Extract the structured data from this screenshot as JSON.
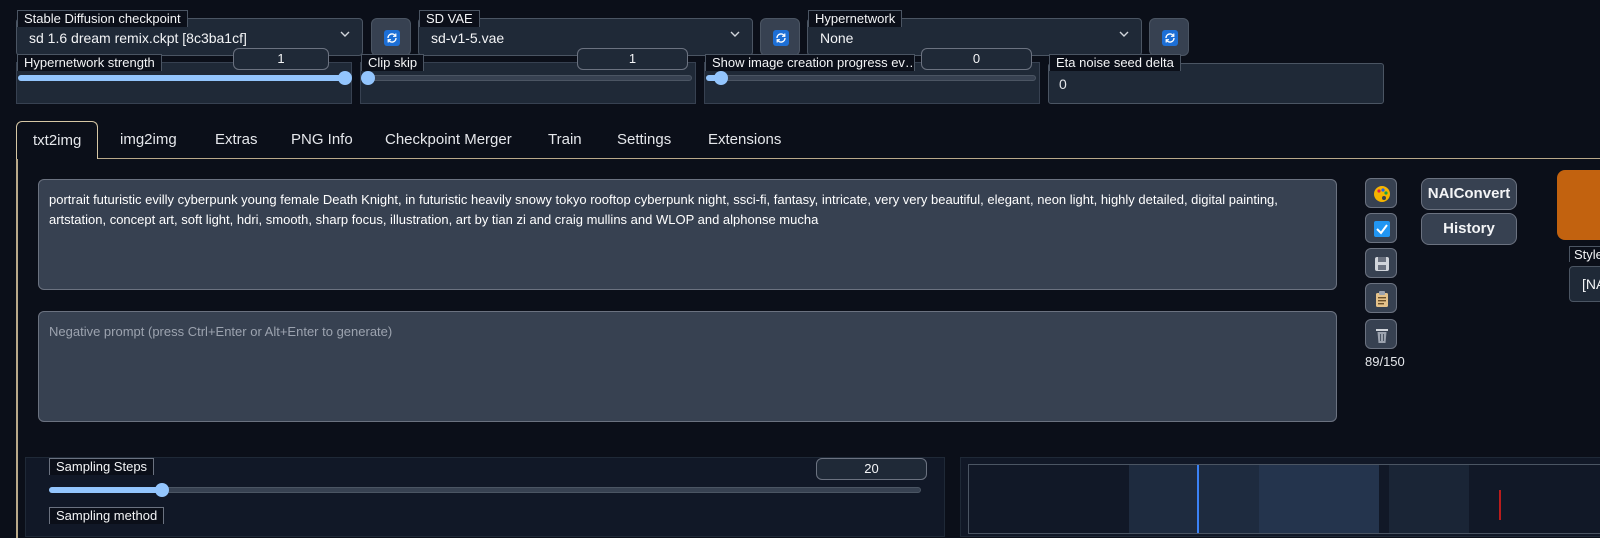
{
  "settings": {
    "checkpoint_label": "Stable Diffusion checkpoint",
    "checkpoint_value": "sd 1.6 dream remix.ckpt [8c3ba1cf]",
    "vae_label": "SD VAE",
    "vae_value": "sd-v1-5.vae",
    "hypernetwork_label": "Hypernetwork",
    "hypernetwork_value": "None",
    "hypernetwork_strength_label": "Hypernetwork strength",
    "hypernetwork_strength_value": "1",
    "clip_skip_label": "Clip skip",
    "clip_skip_value": "1",
    "progress_label": "Show image creation progress ev…",
    "progress_value": "0",
    "eta_label": "Eta noise seed delta",
    "eta_value": "0"
  },
  "tabs": [
    "txt2img",
    "img2img",
    "Extras",
    "PNG Info",
    "Checkpoint Merger",
    "Train",
    "Settings",
    "Extensions"
  ],
  "active_tab": "txt2img",
  "prompt": {
    "text": "portrait futuristic evilly cyberpunk young female Death Knight, in futuristic heavily snowy tokyo rooftop cyberpunk night, ssci-fi, fantasy, intricate, very very beautiful, elegant, neon light, highly detailed, digital painting, artstation, concept art, soft light, hdri, smooth, sharp focus, illustration, art by tian zi and craig mullins and WLOP and alphonse mucha",
    "negative_placeholder": "Negative prompt (press Ctrl+Enter or Alt+Enter to generate)",
    "token_counter": "89/150"
  },
  "tools": [
    "palette-icon",
    "checkbox-icon",
    "save-icon",
    "clipboard-icon",
    "trash-icon"
  ],
  "side_buttons": {
    "naiconvert": "NAIConvert",
    "history": "History"
  },
  "styles": {
    "label": "Style",
    "value": "[NA"
  },
  "sampling": {
    "steps_label": "Sampling Steps",
    "steps_value": "20",
    "steps_fraction": 0.13,
    "method_label": "Sampling method"
  },
  "colors": {
    "accent": "#93c5fd",
    "generate": "#c2620f",
    "background": "#0b0f19",
    "panel": "#1f2937"
  }
}
